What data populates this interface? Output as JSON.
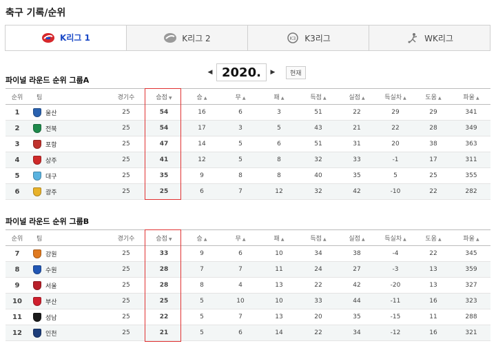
{
  "page": {
    "title": "축구 기록/순위"
  },
  "tabs": [
    {
      "label": "K리그 1",
      "icon": "k-league-1-logo",
      "color": "#d6282c"
    },
    {
      "label": "K리그 2",
      "icon": "k-league-2-logo",
      "color": "#888888"
    },
    {
      "label": "K3리그",
      "icon": "k3-league-logo",
      "color": "#888888"
    },
    {
      "label": "WK리그",
      "icon": "wk-league-logo",
      "color": "#888888"
    }
  ],
  "season": {
    "year": "2020.",
    "prev": "◀",
    "next": "▶",
    "now_label": "현재"
  },
  "columns": {
    "rank": "순위",
    "team": "팀",
    "played": "경기수",
    "points": "승점",
    "win": "승",
    "draw": "무",
    "loss": "패",
    "gf": "득점",
    "ga": "실점",
    "gd": "득실차",
    "assists": "도움",
    "fouls": "파울"
  },
  "group_a": {
    "title": "파이널 라운드 순위 그룹A",
    "rows": [
      {
        "rank": "1",
        "team": "울산",
        "crest": "#2a62b0",
        "played": "25",
        "points": "54",
        "win": "16",
        "draw": "6",
        "loss": "3",
        "gf": "51",
        "ga": "22",
        "gd": "29",
        "assists": "29",
        "fouls": "341"
      },
      {
        "rank": "2",
        "team": "전북",
        "crest": "#1f8a4c",
        "played": "25",
        "points": "54",
        "win": "17",
        "draw": "3",
        "loss": "5",
        "gf": "43",
        "ga": "21",
        "gd": "22",
        "assists": "28",
        "fouls": "349"
      },
      {
        "rank": "3",
        "team": "포항",
        "crest": "#c0322d",
        "played": "25",
        "points": "47",
        "win": "14",
        "draw": "5",
        "loss": "6",
        "gf": "51",
        "ga": "31",
        "gd": "20",
        "assists": "38",
        "fouls": "363"
      },
      {
        "rank": "4",
        "team": "상주",
        "crest": "#cf2a2a",
        "played": "25",
        "points": "41",
        "win": "12",
        "draw": "5",
        "loss": "8",
        "gf": "32",
        "ga": "33",
        "gd": "-1",
        "assists": "17",
        "fouls": "311"
      },
      {
        "rank": "5",
        "team": "대구",
        "crest": "#5ab3e0",
        "played": "25",
        "points": "35",
        "win": "9",
        "draw": "8",
        "loss": "8",
        "gf": "40",
        "ga": "35",
        "gd": "5",
        "assists": "25",
        "fouls": "355"
      },
      {
        "rank": "6",
        "team": "광주",
        "crest": "#e8b22a",
        "played": "25",
        "points": "25",
        "win": "6",
        "draw": "7",
        "loss": "12",
        "gf": "32",
        "ga": "42",
        "gd": "-10",
        "assists": "22",
        "fouls": "282"
      }
    ]
  },
  "group_b": {
    "title": "파이널 라운드 순위 그룹B",
    "rows": [
      {
        "rank": "7",
        "team": "강원",
        "crest": "#e07a20",
        "played": "25",
        "points": "33",
        "win": "9",
        "draw": "6",
        "loss": "10",
        "gf": "34",
        "ga": "38",
        "gd": "-4",
        "assists": "22",
        "fouls": "345"
      },
      {
        "rank": "8",
        "team": "수원",
        "crest": "#2257b4",
        "played": "25",
        "points": "28",
        "win": "7",
        "draw": "7",
        "loss": "11",
        "gf": "24",
        "ga": "27",
        "gd": "-3",
        "assists": "13",
        "fouls": "359"
      },
      {
        "rank": "9",
        "team": "서울",
        "crest": "#b8202a",
        "played": "25",
        "points": "28",
        "win": "8",
        "draw": "4",
        "loss": "13",
        "gf": "22",
        "ga": "42",
        "gd": "-20",
        "assists": "13",
        "fouls": "327"
      },
      {
        "rank": "10",
        "team": "부산",
        "crest": "#d0202e",
        "played": "25",
        "points": "25",
        "win": "5",
        "draw": "10",
        "loss": "10",
        "gf": "33",
        "ga": "44",
        "gd": "-11",
        "assists": "16",
        "fouls": "323"
      },
      {
        "rank": "11",
        "team": "성남",
        "crest": "#1b1b1b",
        "played": "25",
        "points": "22",
        "win": "5",
        "draw": "7",
        "loss": "13",
        "gf": "20",
        "ga": "35",
        "gd": "-15",
        "assists": "11",
        "fouls": "288"
      },
      {
        "rank": "12",
        "team": "인천",
        "crest": "#1c3d7a",
        "played": "25",
        "points": "21",
        "win": "5",
        "draw": "6",
        "loss": "14",
        "gf": "22",
        "ga": "34",
        "gd": "-12",
        "assists": "16",
        "fouls": "321"
      }
    ]
  }
}
